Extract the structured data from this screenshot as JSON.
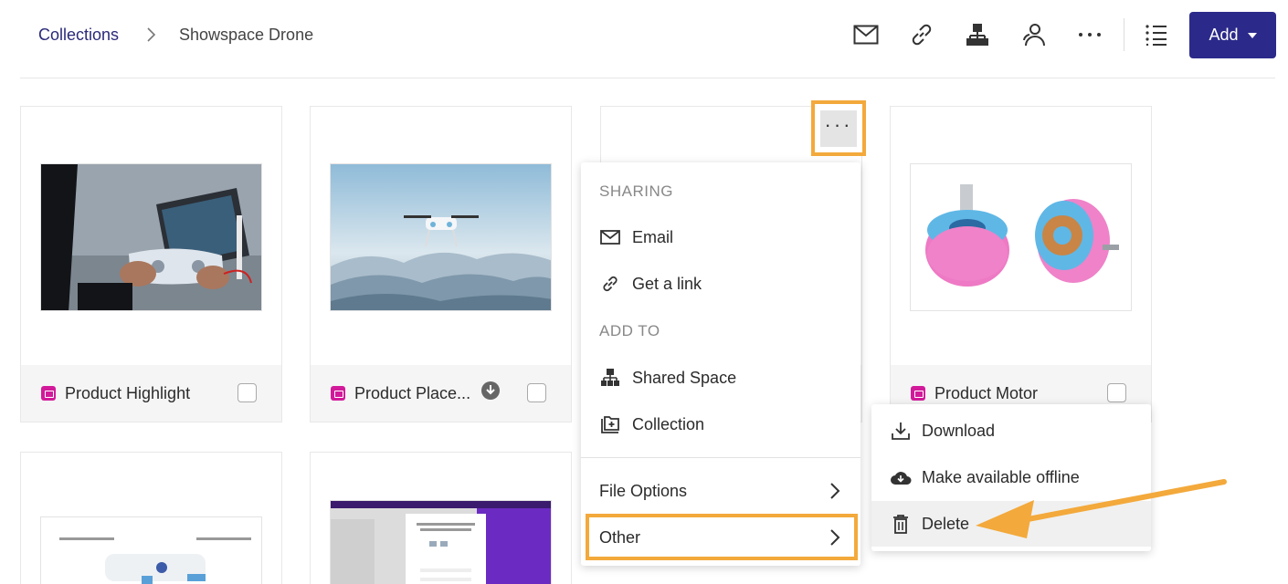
{
  "breadcrumb": {
    "root": "Collections",
    "current": "Showspace Drone"
  },
  "toolbar": {
    "icons": [
      "mail-icon",
      "link-icon",
      "shared-space-icon",
      "people-icon",
      "more-icon",
      "list-view-icon"
    ],
    "add_label": "Add"
  },
  "cards": [
    {
      "title": "Product Highlight",
      "type": "image"
    },
    {
      "title": "Product Place...",
      "type": "image",
      "badge": "download-icon"
    },
    {
      "title": "",
      "type": "image"
    },
    {
      "title": "Product Motor",
      "type": "image"
    },
    {
      "title": "",
      "type": "image"
    },
    {
      "title": "",
      "type": "image"
    }
  ],
  "menu": {
    "sections": {
      "sharing": "SHARING",
      "add_to": "ADD TO"
    },
    "items": {
      "email": "Email",
      "get_link": "Get a link",
      "shared_space": "Shared Space",
      "collection": "Collection",
      "file_options": "File Options",
      "other": "Other"
    }
  },
  "submenu": {
    "download": "Download",
    "offline": "Make available offline",
    "delete": "Delete"
  },
  "colors": {
    "accent": "#2b2a8a",
    "highlight": "#f3a93b",
    "badge": "#d21a9a"
  }
}
